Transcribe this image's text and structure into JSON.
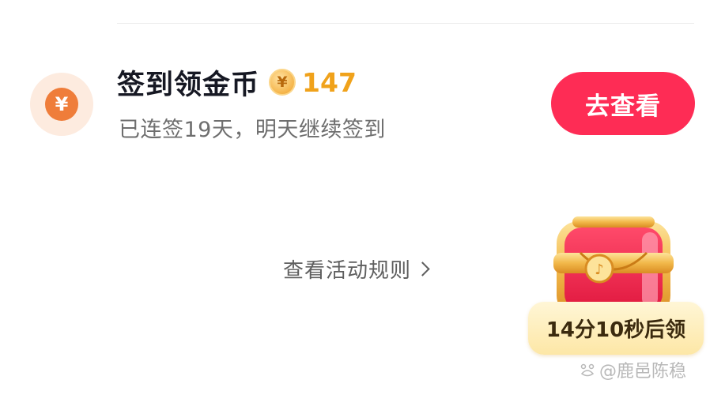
{
  "task": {
    "title": "签到领金币",
    "coin_symbol": "¥",
    "coin_count": "147",
    "subtitle": "已连签19天，明天继续签到",
    "icon_symbol": "¥",
    "button_label": "去查看"
  },
  "rules_link": {
    "label": "查看活动规则"
  },
  "treasure_chest": {
    "timer_text": "14分10秒后领"
  },
  "watermark": {
    "text": "@鹿邑陈稳"
  },
  "colors": {
    "primary_button": "#fe2c55",
    "coin_text": "#f0a21b",
    "title_text": "#161823",
    "subtitle_text": "#6e6e6e"
  }
}
